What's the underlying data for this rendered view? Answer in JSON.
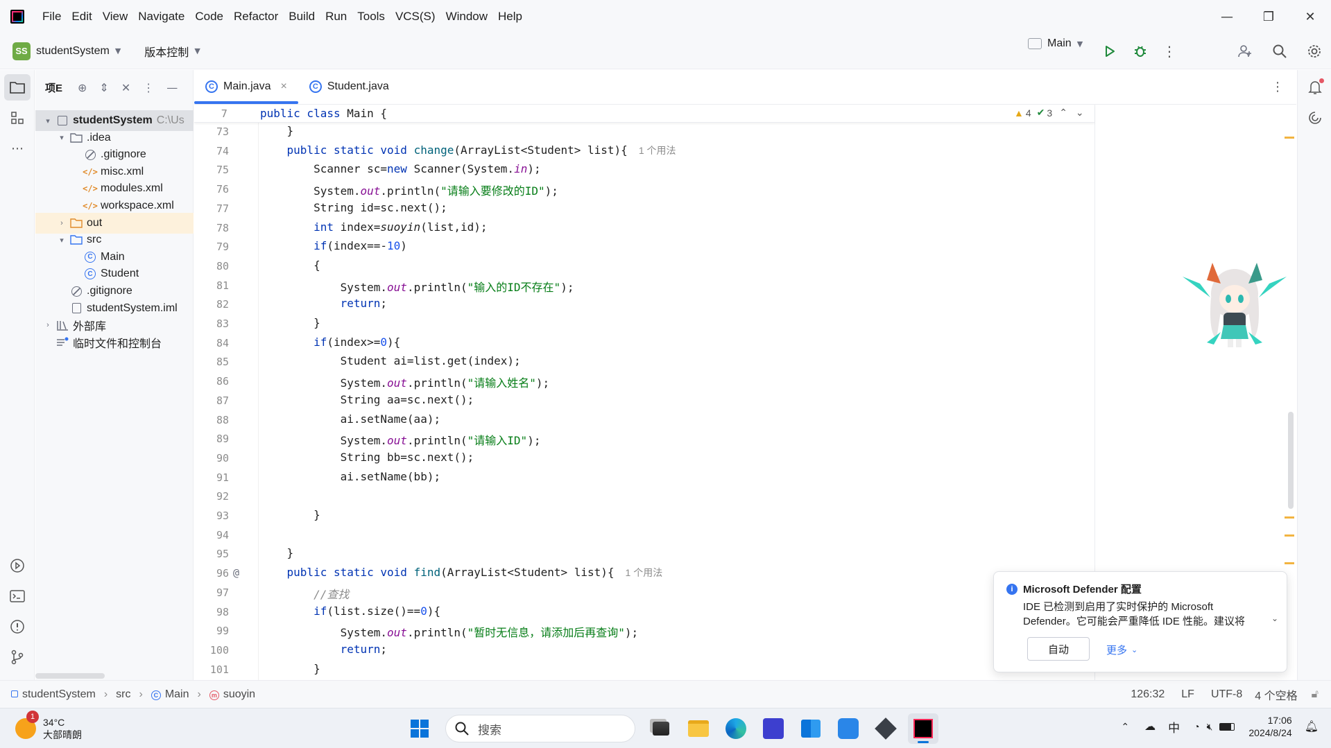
{
  "titlebar": {
    "menu": [
      "File",
      "Edit",
      "View",
      "Navigate",
      "Code",
      "Refactor",
      "Build",
      "Run",
      "Tools",
      "VCS(S)",
      "Window",
      "Help"
    ],
    "controls": [
      "—",
      "❐",
      "✕"
    ]
  },
  "toolbar": {
    "project_badge": "SS",
    "project_name": "studentSystem",
    "vcs_label": "版本控制",
    "run_config": "Main"
  },
  "project_panel": {
    "title": "项E",
    "tree": [
      {
        "label": "studentSystem",
        "extra": "C:\\Us",
        "depth": 0,
        "arrow": "▾",
        "icon": "module",
        "bold": true
      },
      {
        "label": ".idea",
        "depth": 1,
        "arrow": "▾",
        "icon": "folder"
      },
      {
        "label": ".gitignore",
        "depth": 2,
        "arrow": "",
        "icon": "ignore"
      },
      {
        "label": "misc.xml",
        "depth": 2,
        "arrow": "",
        "icon": "xml"
      },
      {
        "label": "modules.xml",
        "depth": 2,
        "arrow": "",
        "icon": "xml"
      },
      {
        "label": "workspace.xml",
        "depth": 2,
        "arrow": "",
        "icon": "xml"
      },
      {
        "label": "out",
        "depth": 1,
        "arrow": "›",
        "icon": "folder-orange",
        "highlight": true
      },
      {
        "label": "src",
        "depth": 1,
        "arrow": "▾",
        "icon": "folder-blue"
      },
      {
        "label": "Main",
        "depth": 2,
        "arrow": "",
        "icon": "class"
      },
      {
        "label": "Student",
        "depth": 2,
        "arrow": "",
        "icon": "class"
      },
      {
        "label": ".gitignore",
        "depth": 1,
        "arrow": "",
        "icon": "ignore"
      },
      {
        "label": "studentSystem.iml",
        "depth": 1,
        "arrow": "",
        "icon": "iml"
      },
      {
        "label": "外部库",
        "depth": 0,
        "arrow": "›",
        "icon": "library"
      },
      {
        "label": "临时文件和控制台",
        "depth": 0,
        "arrow": "",
        "icon": "scratch"
      }
    ]
  },
  "editor": {
    "tabs": [
      {
        "label": "Main.java",
        "active": true,
        "close": "×"
      },
      {
        "label": "Student.java",
        "active": false
      }
    ],
    "sticky": {
      "line": "7",
      "code": "public class Main {"
    },
    "inspections": {
      "warnings": "4",
      "checks": "3"
    },
    "lines": [
      {
        "n": "73",
        "t": [
          [
            "",
            "    }"
          ]
        ]
      },
      {
        "n": "74",
        "t": [
          [
            "",
            "    "
          ],
          [
            "k",
            "public static void "
          ],
          [
            "m",
            "change"
          ],
          [
            "",
            "(ArrayList<Student> list){"
          ]
        ],
        "hint": "1 个用法"
      },
      {
        "n": "75",
        "t": [
          [
            "",
            "        Scanner sc="
          ],
          [
            "k",
            "new "
          ],
          [
            "",
            "Scanner(System."
          ],
          [
            "f",
            "in"
          ],
          [
            "",
            ");"
          ]
        ]
      },
      {
        "n": "76",
        "t": [
          [
            "",
            "        System."
          ],
          [
            "f",
            "out"
          ],
          [
            "",
            ".println("
          ],
          [
            "s",
            "\"请输入要修改的ID\""
          ],
          [
            "",
            ");"
          ]
        ]
      },
      {
        "n": "77",
        "t": [
          [
            "",
            "        String id=sc.next();"
          ]
        ]
      },
      {
        "n": "78",
        "t": [
          [
            "",
            "        "
          ],
          [
            "k",
            "int "
          ],
          [
            "",
            "index="
          ],
          [
            "st",
            "suoyin"
          ],
          [
            "",
            "(list,id);"
          ]
        ]
      },
      {
        "n": "79",
        "t": [
          [
            "",
            "        "
          ],
          [
            "k",
            "if"
          ],
          [
            "",
            "(index==-"
          ],
          [
            "n",
            "10"
          ],
          [
            "",
            ")"
          ]
        ]
      },
      {
        "n": "80",
        "t": [
          [
            "",
            "        {"
          ]
        ]
      },
      {
        "n": "81",
        "t": [
          [
            "",
            "            System."
          ],
          [
            "f",
            "out"
          ],
          [
            "",
            ".println("
          ],
          [
            "s",
            "\"输入的ID不存在\""
          ],
          [
            "",
            ");"
          ]
        ]
      },
      {
        "n": "82",
        "t": [
          [
            "",
            "            "
          ],
          [
            "k",
            "return"
          ],
          [
            "",
            ";"
          ]
        ]
      },
      {
        "n": "83",
        "t": [
          [
            "",
            "        }"
          ]
        ]
      },
      {
        "n": "84",
        "t": [
          [
            "",
            "        "
          ],
          [
            "k",
            "if"
          ],
          [
            "",
            "(index>="
          ],
          [
            "n",
            "0"
          ],
          [
            "",
            "){"
          ]
        ]
      },
      {
        "n": "85",
        "t": [
          [
            "",
            "            Student ai=list.get(index);"
          ]
        ]
      },
      {
        "n": "86",
        "t": [
          [
            "",
            "            System."
          ],
          [
            "f",
            "out"
          ],
          [
            "",
            ".println("
          ],
          [
            "s",
            "\"请输入姓名\""
          ],
          [
            "",
            ");"
          ]
        ]
      },
      {
        "n": "87",
        "t": [
          [
            "",
            "            String aa=sc.next();"
          ]
        ]
      },
      {
        "n": "88",
        "t": [
          [
            "",
            "            ai.setName(aa);"
          ]
        ]
      },
      {
        "n": "89",
        "t": [
          [
            "",
            "            System."
          ],
          [
            "f",
            "out"
          ],
          [
            "",
            ".println("
          ],
          [
            "s",
            "\"请输入ID\""
          ],
          [
            "",
            ");"
          ]
        ]
      },
      {
        "n": "90",
        "t": [
          [
            "",
            "            String bb=sc.next();"
          ]
        ]
      },
      {
        "n": "91",
        "t": [
          [
            "",
            "            ai.setName(bb);"
          ]
        ]
      },
      {
        "n": "92",
        "t": [
          [
            "",
            ""
          ]
        ]
      },
      {
        "n": "93",
        "t": [
          [
            "",
            "        }"
          ]
        ]
      },
      {
        "n": "94",
        "t": [
          [
            "",
            ""
          ]
        ]
      },
      {
        "n": "95",
        "t": [
          [
            "",
            "    }"
          ]
        ]
      },
      {
        "n": "96",
        "t": [
          [
            "",
            "    "
          ],
          [
            "k",
            "public static void "
          ],
          [
            "m",
            "find"
          ],
          [
            "",
            "(ArrayList<Student> list){"
          ]
        ],
        "hint": "1 个用法",
        "gutter": "@"
      },
      {
        "n": "97",
        "t": [
          [
            "",
            "        "
          ],
          [
            "c",
            "//查找"
          ]
        ]
      },
      {
        "n": "98",
        "t": [
          [
            "",
            "        "
          ],
          [
            "k",
            "if"
          ],
          [
            "",
            "(list.size()=="
          ],
          [
            "n",
            "0"
          ],
          [
            "",
            "){"
          ]
        ]
      },
      {
        "n": "99",
        "t": [
          [
            "",
            "            System."
          ],
          [
            "f",
            "out"
          ],
          [
            "",
            ".println("
          ],
          [
            "s",
            "\"暂时无信息，请添加后再查询\""
          ],
          [
            "",
            ");"
          ]
        ]
      },
      {
        "n": "100",
        "t": [
          [
            "",
            "            "
          ],
          [
            "k",
            "return"
          ],
          [
            "",
            ";"
          ]
        ]
      },
      {
        "n": "101",
        "t": [
          [
            "",
            "        }"
          ]
        ]
      }
    ]
  },
  "notification": {
    "title": "Microsoft Defender 配置",
    "body_line1": "IDE 已检测到启用了实时保护的 Microsoft",
    "body_line2": "Defender。它可能会严重降低 IDE 性能。建议将",
    "button": "自动",
    "more": "更多"
  },
  "statusbar": {
    "breadcrumb": [
      "studentSystem",
      "src",
      "Main",
      "suoyin"
    ],
    "position": "126:32",
    "line_sep": "LF",
    "encoding": "UTF-8",
    "indent": "4 个空格"
  },
  "taskbar": {
    "weather_temp": "34°C",
    "weather_desc": "大部晴朗",
    "weather_badge": "1",
    "search_placeholder": "搜索",
    "ime": "中",
    "time": "17:06",
    "date": "2024/8/24"
  },
  "colors": {
    "accent": "#3574f0",
    "keyword": "#0033b3",
    "string": "#067d17",
    "number": "#1750eb",
    "field": "#871094"
  }
}
